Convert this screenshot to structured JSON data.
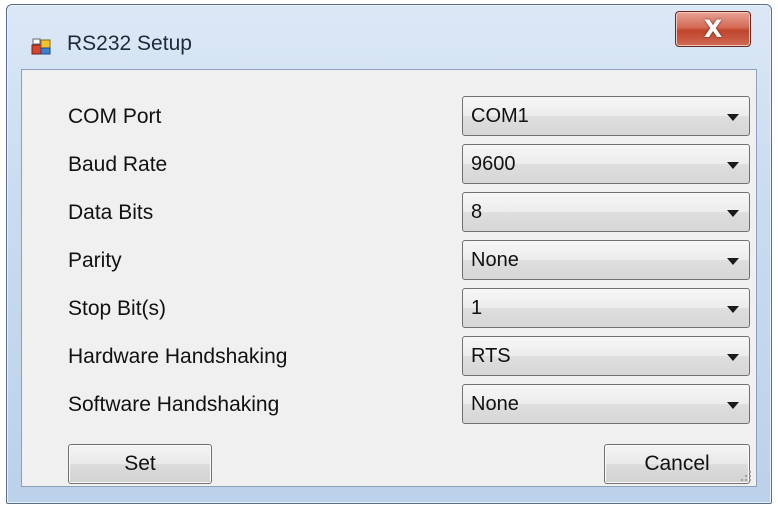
{
  "window": {
    "title": "RS232 Setup",
    "close_label": "X"
  },
  "fields": [
    {
      "label": "COM Port",
      "value": "COM1"
    },
    {
      "label": "Baud Rate",
      "value": "9600"
    },
    {
      "label": "Data Bits",
      "value": "8"
    },
    {
      "label": "Parity",
      "value": "None"
    },
    {
      "label": "Stop Bit(s)",
      "value": "1"
    },
    {
      "label": "Hardware Handshaking",
      "value": "RTS"
    },
    {
      "label": "Software Handshaking",
      "value": "None"
    }
  ],
  "buttons": {
    "set_label": "Set",
    "cancel_label": "Cancel"
  },
  "colors": {
    "close_button": "#c0442c",
    "title_gradient_top": "#dbe8f6",
    "client_background": "#f0f0f0"
  },
  "icons": {
    "app": "window-app-icon",
    "dropdown": "chevron-down-icon",
    "resize": "resize-grip-icon"
  }
}
